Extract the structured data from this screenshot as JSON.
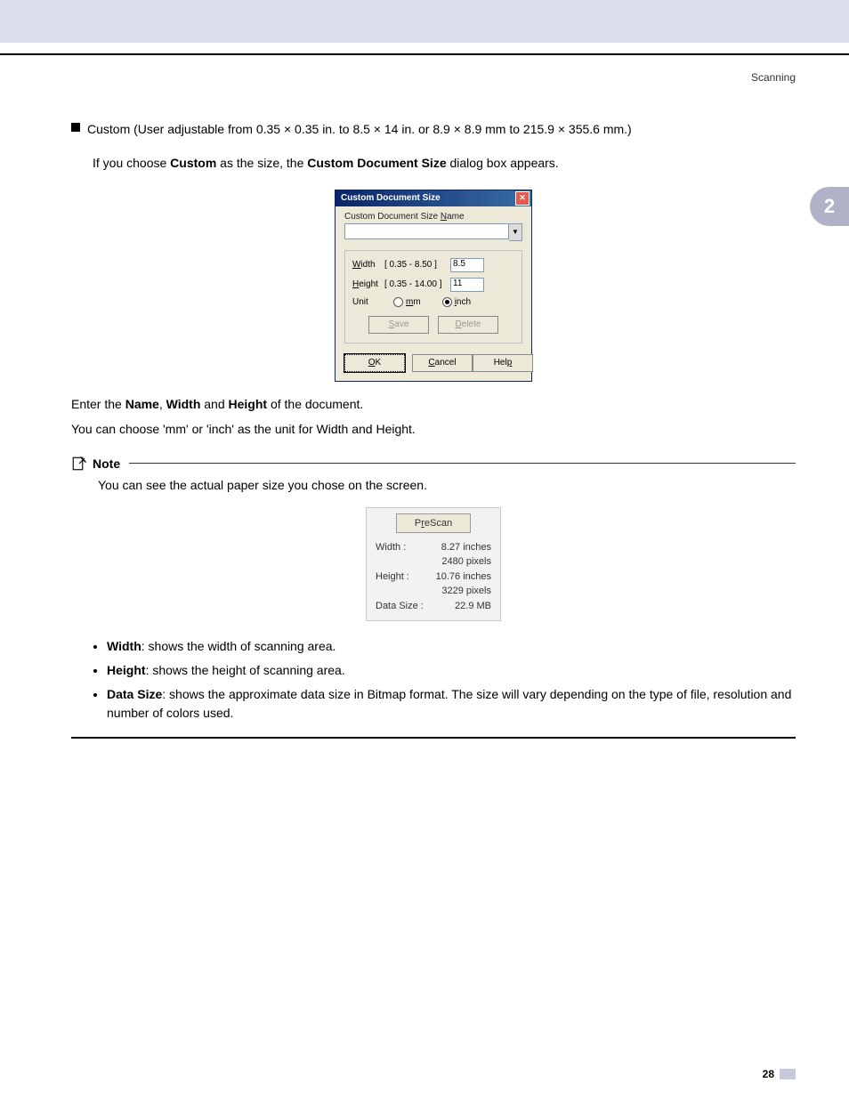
{
  "header": {
    "section": "Scanning"
  },
  "tab": {
    "number": "2"
  },
  "line1": {
    "prefix": "Custom (User adjustable from 0.35 ",
    "seg2": " 0.35 in. to 8.5 ",
    "seg3": " 14 in. or 8.9 ",
    "seg4": " 8.9 mm to 215.9 ",
    "seg5": " 355.6 mm.)",
    "times": "×"
  },
  "line2": {
    "a": "If you choose ",
    "b": "Custom",
    "c": " as the size, the ",
    "d": "Custom Document Size",
    "e": " dialog box appears."
  },
  "dialog": {
    "title": "Custom Document Size",
    "nameLabelPre": "Custom Document Size ",
    "nameLabelU": "N",
    "nameLabelPost": "ame",
    "nameValue": "",
    "width": {
      "labU": "W",
      "labRest": "idth",
      "range": "[ 0.35 -   8.50 ]",
      "value": "8.5"
    },
    "height": {
      "labU": "H",
      "labRest": "eight",
      "range": "[ 0.35 - 14.00 ]",
      "value": "11"
    },
    "unitLabel": "Unit",
    "mm": {
      "u": "m",
      "rest": "m"
    },
    "inch": {
      "u": "i",
      "rest": "nch"
    },
    "save": {
      "u": "S",
      "rest": "ave"
    },
    "delete": {
      "u": "D",
      "rest": "elete"
    },
    "ok": {
      "u": "O",
      "rest": "K"
    },
    "cancel": {
      "u": "C",
      "rest": "ancel"
    },
    "help": {
      "pre": "Hel",
      "u": "p"
    }
  },
  "body": {
    "enter": {
      "a": "Enter the ",
      "n": "Name",
      "c1": ", ",
      "w": "Width",
      "c2": " and ",
      "h": "Height",
      "end": " of the document."
    },
    "unitline": "You can choose 'mm' or 'inch' as the unit for Width and Height.",
    "noteLabel": "Note",
    "noteText": "You can see the actual paper size you chose on the screen."
  },
  "prescan": {
    "btn": {
      "pre": "P",
      "u": "r",
      "post": "eScan"
    },
    "rows": {
      "wlab": "Width :",
      "wval": "8.27 inches",
      "wpix": "2480 pixels",
      "hlab": "Height :",
      "hval": "10.76 inches",
      "hpix": "3229 pixels",
      "dlab": "Data Size :",
      "dval": "22.9 MB"
    }
  },
  "bullets": {
    "w": {
      "t": "Width",
      "d": ": shows the width of scanning area."
    },
    "h": {
      "t": "Height",
      "d": ": shows the height of scanning area."
    },
    "ds": {
      "t": "Data Size",
      "d": ": shows the approximate data size in Bitmap format. The size will vary depending on the type of file, resolution and number of colors used."
    }
  },
  "page": {
    "num": "28"
  }
}
